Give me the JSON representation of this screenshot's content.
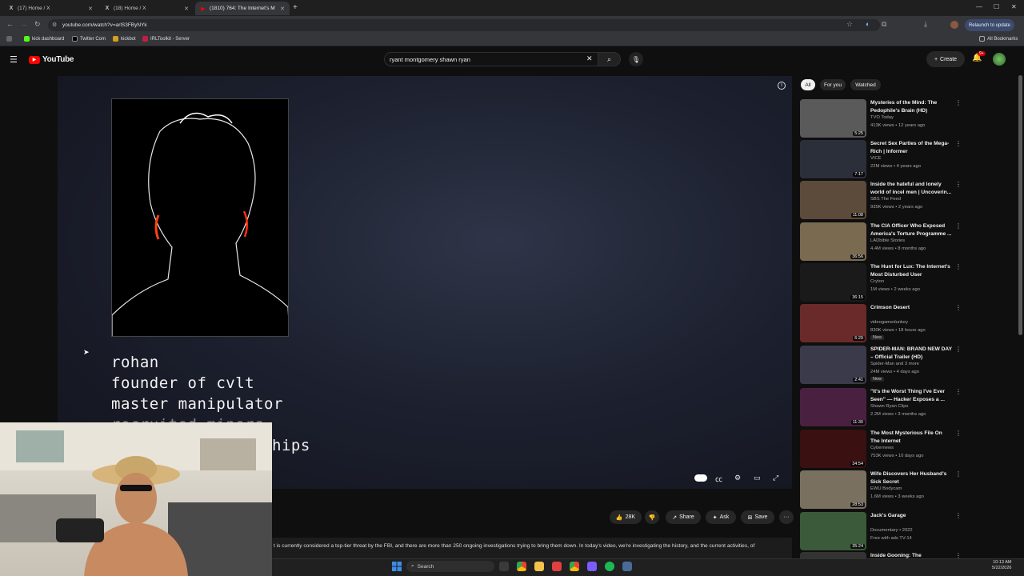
{
  "browser": {
    "tabs": [
      {
        "label": "(17) Home / X",
        "fav": "X"
      },
      {
        "label": "(18) Home / X",
        "fav": "X"
      },
      {
        "label": "(1810) 764: The Internet's M",
        "fav": "▶"
      }
    ],
    "url": "youtube.com/watch?v=arlS3FByNYk",
    "relaunch": "Relaunch to update",
    "bookmarks": [
      "kick dashboard",
      "Twitter Com",
      "kickbot",
      "IRLToolkit - Server"
    ],
    "all_bookmarks": "All Bookmarks"
  },
  "youtube": {
    "logo": "YouTube",
    "search_value": "ryant montgomery shawn ryan",
    "create_label": "Create",
    "notif_count": "9+"
  },
  "video": {
    "caption_lines": [
      "rohan",
      "founder of cvlt",
      "master manipulator",
      "recruited minors",
      "hips"
    ]
  },
  "actions": {
    "like_count": "28K",
    "share": "Share",
    "ask": "Ask",
    "save": "Save"
  },
  "description": "t is currently considered a top-tier threat by the FBI, and there are more than 250 ongoing investigations trying to bring them down. In today's video, we're investigating the history, and the current activities, of",
  "sidebar": {
    "chips": [
      "All",
      "For you",
      "Watched"
    ],
    "items": [
      {
        "title": "Mysteries of the Mind: The Pedophile's Brain (HD)",
        "channel": "TVO Today",
        "meta": "413K views • 12 years ago",
        "duration": "5:25",
        "color": "#5a5a5a"
      },
      {
        "title": "Secret Sex Parties of the Mega-Rich | Informer",
        "channel": "VICE",
        "meta": "22M views • 4 years ago",
        "duration": "7:17",
        "color": "#2b2f3a"
      },
      {
        "title": "Inside the hateful and lonely world of incel men | Uncoverin...",
        "channel": "SBS The Feed",
        "meta": "935K views • 2 years ago",
        "duration": "11:08",
        "color": "#5c4a3a"
      },
      {
        "title": "The CIA Officer Who Exposed America's Torture Programme ...",
        "channel": "LADbible Stories",
        "meta": "4.4M views • 8 months ago",
        "duration": "36:56",
        "color": "#7a6a50"
      },
      {
        "title": "The Hunt for Lux: The Internet's Most Disturbed User",
        "channel": "Cryton",
        "meta": "1M views • 2 weeks ago",
        "duration": "36:15",
        "color": "#1a1a1a"
      },
      {
        "title": "Crimson Desert",
        "channel": "videogamedunkey",
        "meta": "830K views • 18 hours ago",
        "duration": "6:29",
        "color": "#6a2a2a",
        "badge": "New"
      },
      {
        "title": "SPIDER-MAN: BRAND NEW DAY – Official Trailer (HD)",
        "channel": "Spider-Man and 3 more",
        "meta": "24M views • 4 days ago",
        "duration": "2:41",
        "color": "#3a3a4a",
        "badge": "New"
      },
      {
        "title": "\"It's the Worst Thing I've Ever Seen\" — Hacker Exposes a ...",
        "channel": "Shawn Ryan Clips",
        "meta": "2.2M views • 3 months ago",
        "duration": "11:30",
        "color": "#4a2040"
      },
      {
        "title": "The Most Mysterious File On The Internet",
        "channel": "Cybernews",
        "meta": "753K views • 10 days ago",
        "duration": "34:54",
        "color": "#3a1010"
      },
      {
        "title": "Wife Discovers Her Husband's Sick Secret",
        "channel": "EWU Bodycam",
        "meta": "1.6M views • 3 weeks ago",
        "duration": "28:53",
        "color": "#7a7060"
      },
      {
        "title": "Jack's Garage",
        "channel": "Documentary • 2022",
        "meta": "Free with ads  TV-14",
        "duration": "35:24",
        "color": "#3a5a3a"
      },
      {
        "title": "Inside Gooning: The",
        "channel": "",
        "meta": "",
        "duration": "",
        "color": "#333"
      }
    ]
  },
  "taskbar": {
    "search": "Search",
    "time": "10:13 AM",
    "date": "5/22/2026"
  }
}
